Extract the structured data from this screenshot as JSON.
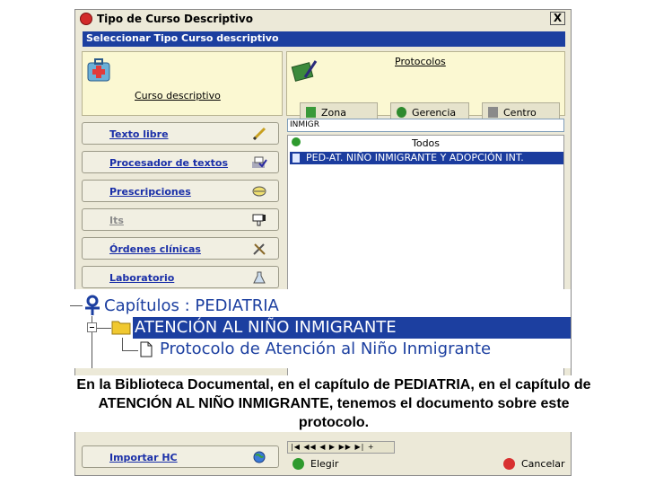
{
  "window": {
    "title": "Tipo de Curso Descriptivo",
    "close_label": "X",
    "subheader": "Seleccionar Tipo Curso descriptivo"
  },
  "left_box": {
    "title": "Curso descriptivo",
    "icon": "first-aid-kit-icon"
  },
  "right_box": {
    "title": "Protocolos",
    "icon": "book-pen-icon",
    "tabs": [
      {
        "label": "Zona",
        "icon": "document-icon"
      },
      {
        "label": "Gerencia",
        "icon": "target-icon"
      },
      {
        "label": "Centro",
        "icon": "building-icon"
      }
    ]
  },
  "nav": [
    {
      "label": "Texto libre",
      "icon": "pencil-icon",
      "enabled": true
    },
    {
      "label": "Procesador de textos",
      "icon": "printer-check-icon",
      "enabled": true
    },
    {
      "label": "Prescripciones",
      "icon": "pill-icon",
      "enabled": true
    },
    {
      "label": "Its",
      "icon": "thumbs-down-icon",
      "enabled": false
    },
    {
      "label": "Órdenes clínicas",
      "icon": "tools-icon",
      "enabled": true
    },
    {
      "label": "Laboratorio",
      "icon": "flask-icon",
      "enabled": true
    }
  ],
  "nav_bottom": {
    "label": "Importar HC",
    "icon": "globe-icon"
  },
  "search": {
    "value": "INMIGR"
  },
  "list": {
    "header": "Todos",
    "rows": [
      {
        "label": "PED-AT. NIÑO INMIGRANTE Y ADOPCIÓN INT.",
        "selected": true
      }
    ]
  },
  "pager": {
    "label": "|◀ ◀◀ ◀ ▶ ▶▶ ▶| +"
  },
  "actions": {
    "ok_label": "Elegir",
    "cancel_label": "Cancelar"
  },
  "tree": {
    "root_label": "Capítulos  : PEDIATRIA",
    "child_label": "ATENCIÓN AL NIÑO INMIGRANTE",
    "leaf_label": "Protocolo de Atención al Niño Inmigrante"
  },
  "caption": {
    "line1": "En la Biblioteca Documental, en el capítulo de PEDIATRIA, en el capítulo de",
    "line2": "ATENCIÓN AL NIÑO INMIGRANTE,  tenemos el documento sobre este",
    "line3": "protocolo."
  },
  "colors": {
    "selection": "#1c3fa0",
    "panel": "#fbf8d2",
    "link": "#1a2fa8"
  }
}
